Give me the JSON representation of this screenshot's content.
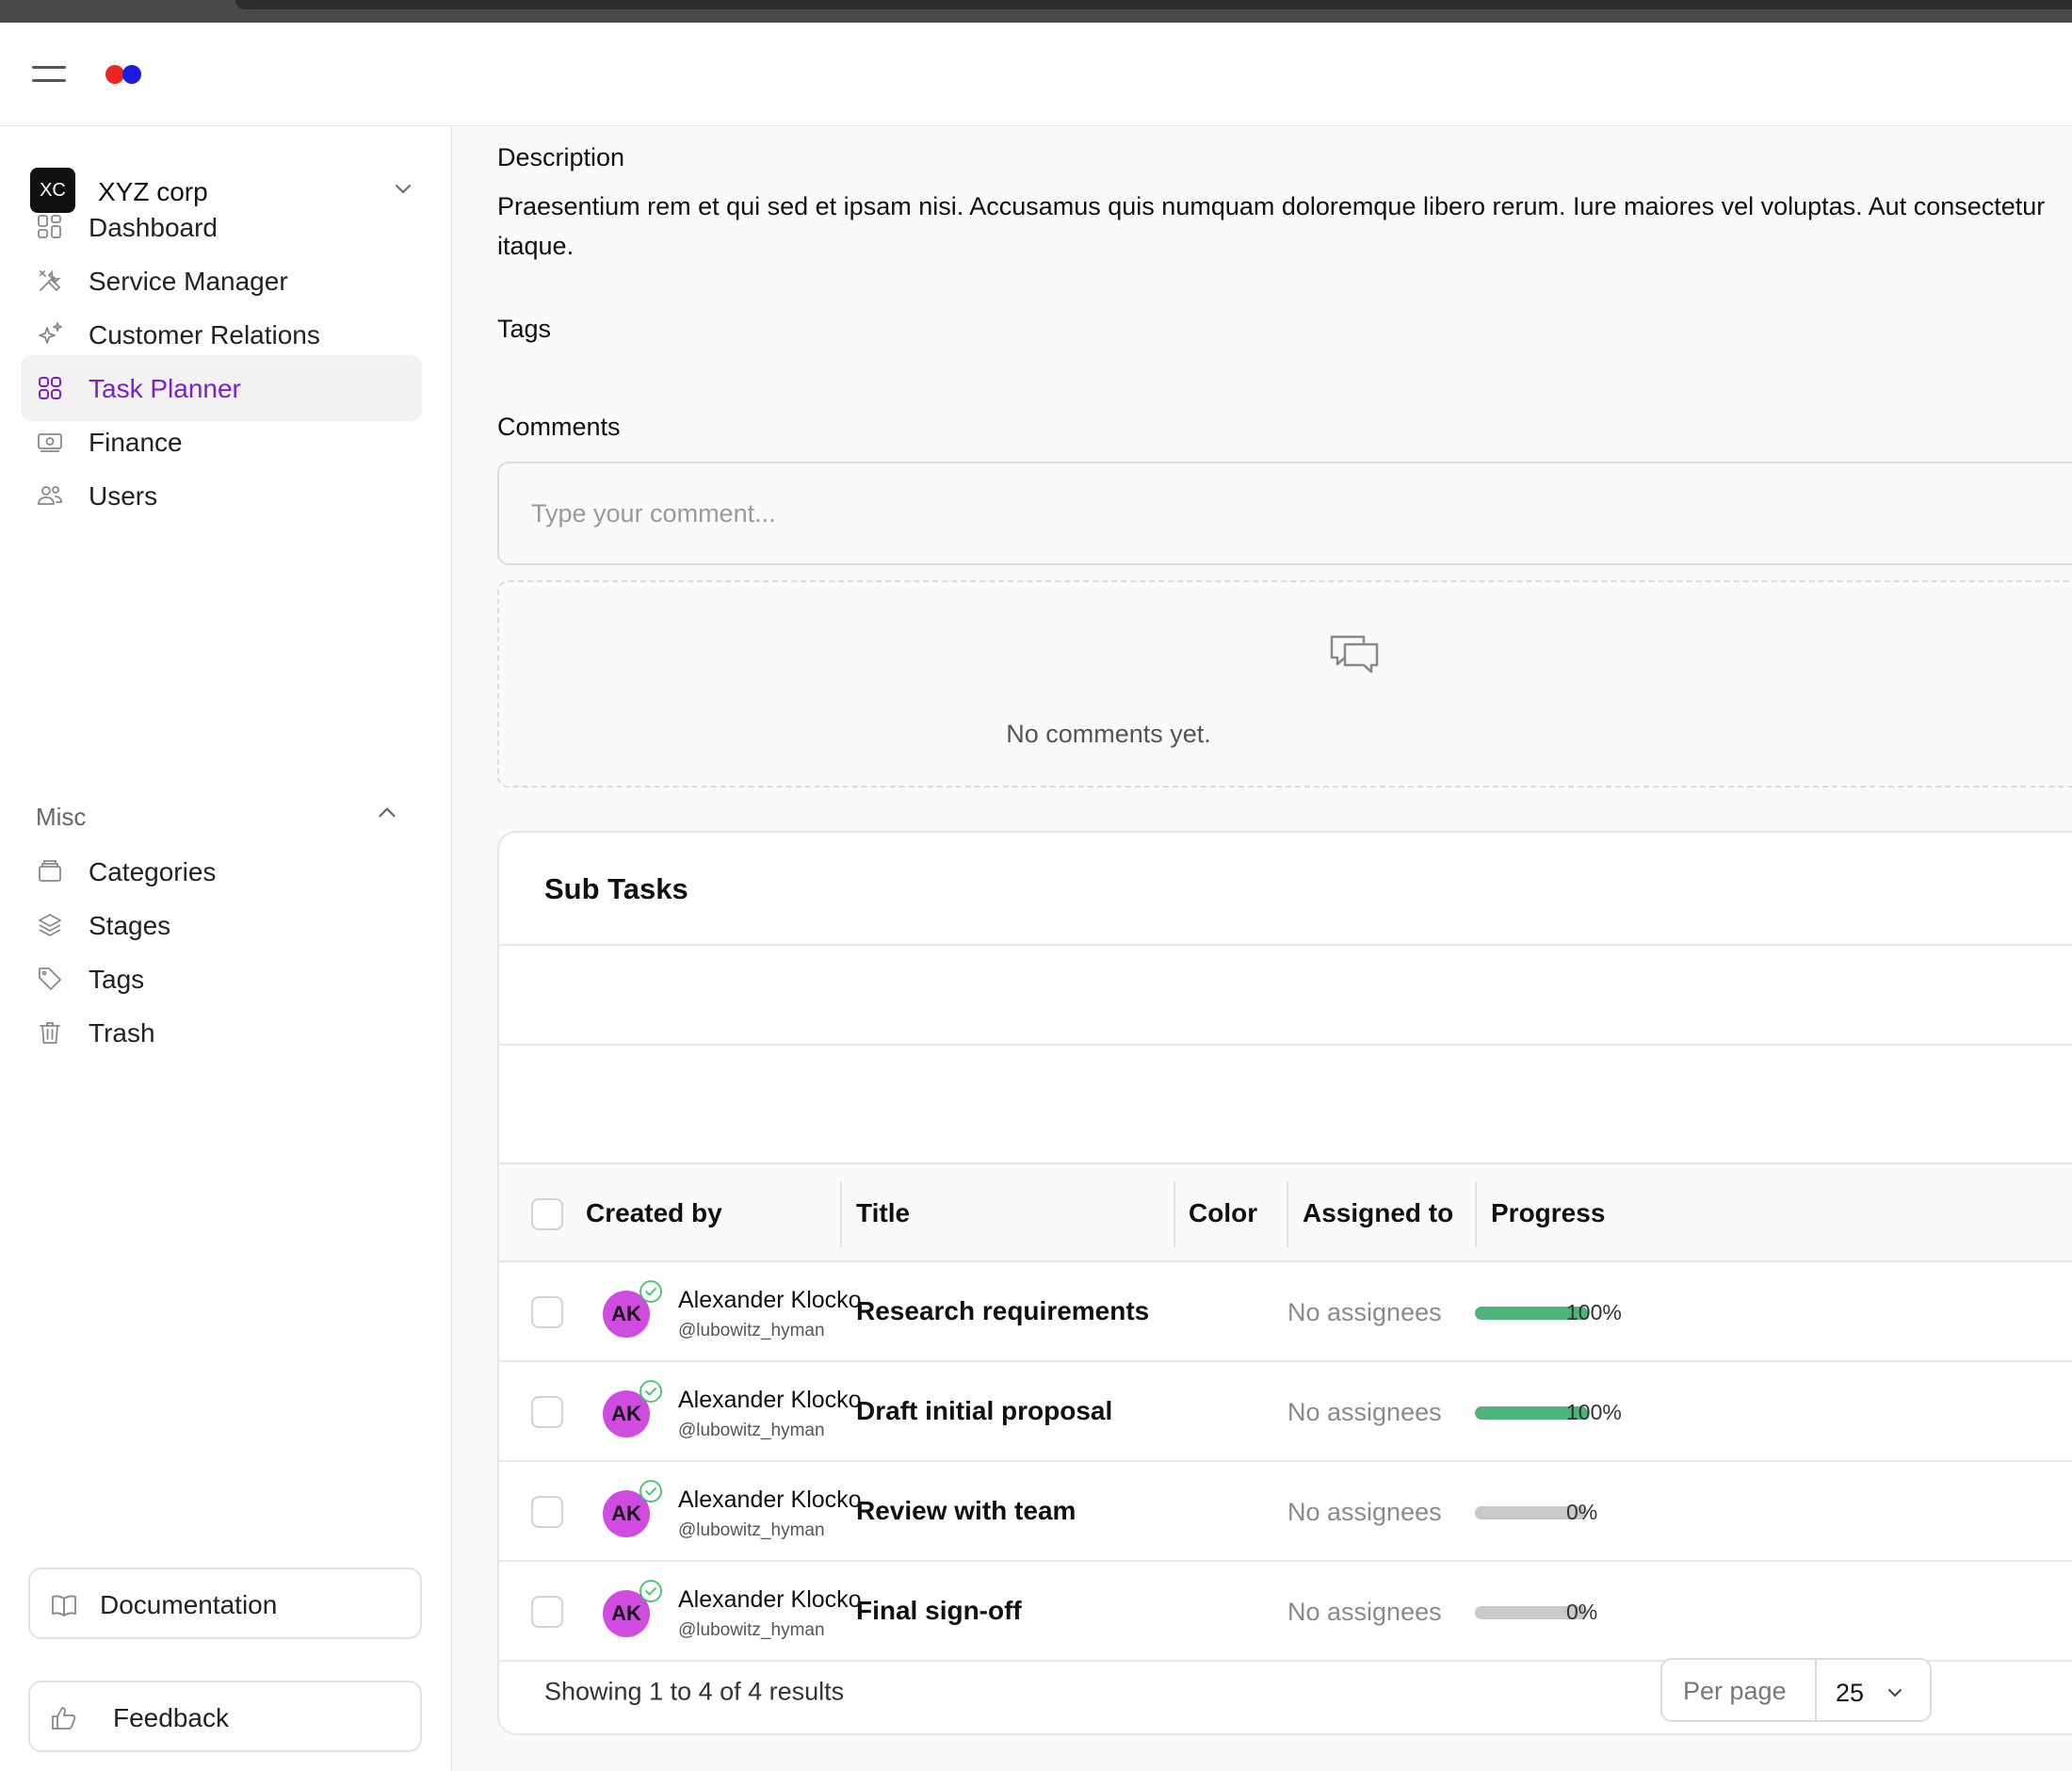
{
  "header": {
    "menu_icon": "hamburger-icon",
    "logo_colors": [
      "#e8281f",
      "#1a1ae0"
    ]
  },
  "sidebar": {
    "org": {
      "badge": "XC",
      "name": "XYZ corp"
    },
    "items": [
      {
        "label": "Dashboard",
        "icon": "grid-icon"
      },
      {
        "label": "Service Manager",
        "icon": "tools-icon"
      },
      {
        "label": "Customer Relations",
        "icon": "sparkles-icon"
      },
      {
        "label": "Task Planner",
        "icon": "squares-icon",
        "active": true
      },
      {
        "label": "Finance",
        "icon": "banknote-icon"
      },
      {
        "label": "Users",
        "icon": "users-icon"
      }
    ],
    "misc": {
      "label": "Misc",
      "items": [
        {
          "label": "Categories",
          "icon": "archive-icon"
        },
        {
          "label": "Stages",
          "icon": "layers-icon"
        },
        {
          "label": "Tags",
          "icon": "tag-icon"
        },
        {
          "label": "Trash",
          "icon": "trash-icon"
        }
      ]
    },
    "documentation_label": "Documentation",
    "feedback_label": "Feedback",
    "accent_color": "#7a1fd6"
  },
  "main": {
    "description_label": "Description",
    "description_text": "Praesentium rem et qui sed et ipsam nisi. Accusamus quis numquam doloremque libero rerum. Iure maiores vel voluptas. Aut consectetur itaque.",
    "tags_label": "Tags",
    "comments_label": "Comments",
    "comment_placeholder": "Type your comment...",
    "no_comments": "No comments yet."
  },
  "subtasks": {
    "title": "Sub Tasks",
    "columns": [
      "Created by",
      "Title",
      "Color",
      "Assigned to",
      "Progress"
    ],
    "rows": [
      {
        "initials": "AK",
        "creator": "Alexander Klocko",
        "handle": "@lubowitz_hyman",
        "title": "Research requirements",
        "assigned": "No assignees",
        "progress": 100,
        "progress_label": "100%"
      },
      {
        "initials": "AK",
        "creator": "Alexander Klocko",
        "handle": "@lubowitz_hyman",
        "title": "Draft initial proposal",
        "assigned": "No assignees",
        "progress": 100,
        "progress_label": "100%"
      },
      {
        "initials": "AK",
        "creator": "Alexander Klocko",
        "handle": "@lubowitz_hyman",
        "title": "Review with team",
        "assigned": "No assignees",
        "progress": 0,
        "progress_label": "0%"
      },
      {
        "initials": "AK",
        "creator": "Alexander Klocko",
        "handle": "@lubowitz_hyman",
        "title": "Final sign-off",
        "assigned": "No assignees",
        "progress": 0,
        "progress_label": "0%"
      }
    ],
    "footer_text": "Showing 1 to 4 of 4 results",
    "per_page_label": "Per page",
    "per_page_value": "25",
    "progress_color": "#4fb37e",
    "avatar_color": "#d04be0"
  }
}
